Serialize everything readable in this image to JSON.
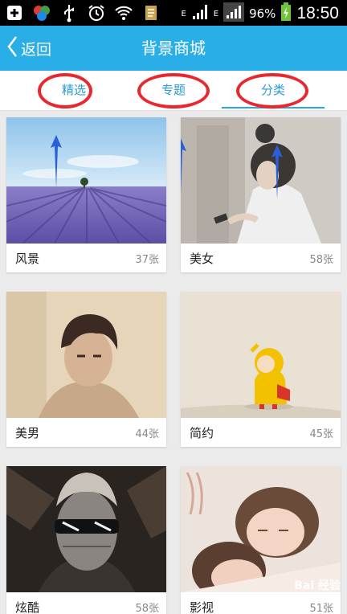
{
  "status_bar": {
    "left_icons": [
      "add-box-icon",
      "color-balls-icon",
      "usb-icon",
      "alarm-icon",
      "wifi-icon",
      "doc-icon"
    ],
    "network_label": "E",
    "battery_percent": "96%",
    "time": "18:50"
  },
  "header": {
    "back_label": "返回",
    "title": "背景商城"
  },
  "tabs": [
    {
      "label": "精选",
      "active": false
    },
    {
      "label": "专题",
      "active": false
    },
    {
      "label": "分类",
      "active": true
    }
  ],
  "categories": [
    {
      "name": "风景",
      "count": "37张"
    },
    {
      "name": "美女",
      "count": "58张"
    },
    {
      "name": "美男",
      "count": "44张"
    },
    {
      "name": "简约",
      "count": "45张"
    },
    {
      "name": "炫酷",
      "count": "58张"
    },
    {
      "name": "影视",
      "count": "51张"
    }
  ],
  "watermark": "Bai 经验",
  "colors": {
    "header_bg": "#29aee7",
    "tab_text": "#2a9ad8",
    "highlight_ring": "#e8282e",
    "annotation_arrow": "#2b5fd9"
  }
}
